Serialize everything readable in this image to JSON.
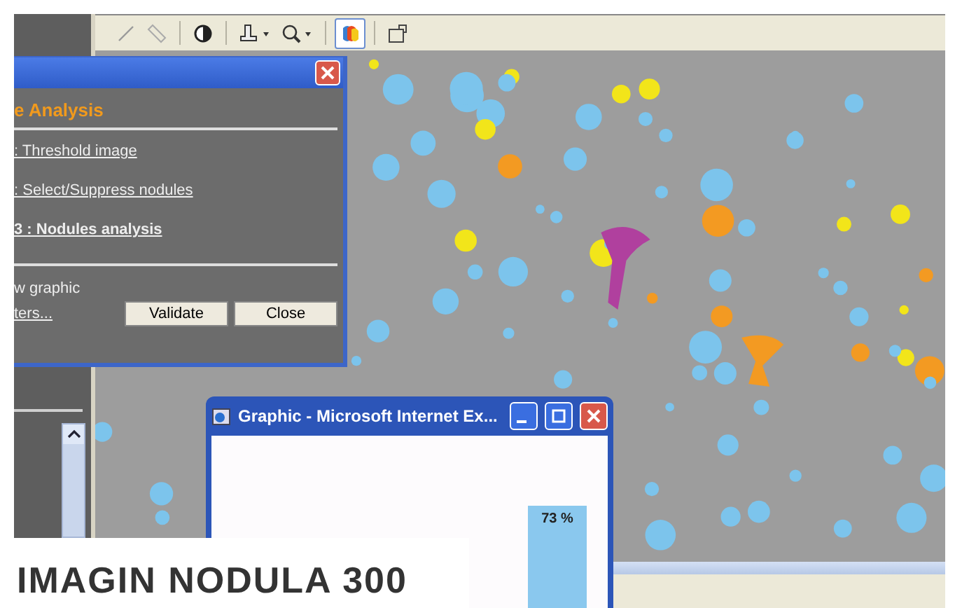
{
  "toolbar": {
    "tools": [
      {
        "kind": "line",
        "selected": false
      },
      {
        "kind": "ruler",
        "selected": false
      },
      {
        "kind": "contrast",
        "selected": false
      },
      {
        "kind": "stamp",
        "selected": false
      },
      {
        "kind": "zoom",
        "selected": false
      },
      {
        "kind": "layers",
        "selected": true
      },
      {
        "kind": "export",
        "selected": false
      }
    ]
  },
  "dialog": {
    "heading": "e Analysis",
    "steps": [
      {
        "label": ": Threshold image",
        "current": false
      },
      {
        "label": ": Select/Suppress nodules",
        "current": false
      },
      {
        "label": "3 : Nodules analysis",
        "current": true
      }
    ],
    "option": "w graphic",
    "link": "ters...",
    "buttons": [
      "Validate",
      "Close"
    ]
  },
  "graphic_window": {
    "title": "Graphic - Microsoft Internet Ex...",
    "bar_label": "73 %"
  },
  "caption": "IMAGIN NODULA 300"
}
